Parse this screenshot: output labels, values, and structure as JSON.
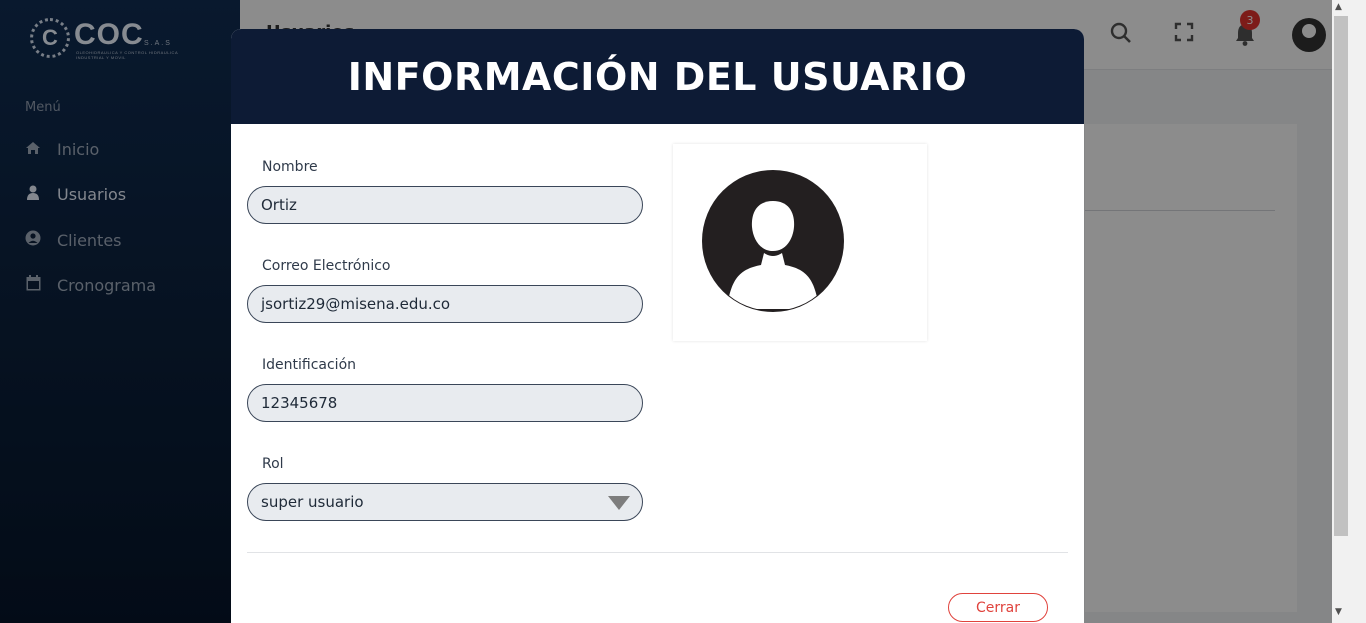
{
  "app": {
    "logo_mark": "C",
    "logo_text": "COC",
    "logo_suffix": "S.A.S",
    "logo_subtitle": "OLEOHIDRAULICA Y CONTROL HIDRAULICA INDUSTRIAL Y MOVIL"
  },
  "sidebar": {
    "menu_title": "Menú",
    "items": [
      {
        "label": "Inicio",
        "icon": "home-icon",
        "active": false
      },
      {
        "label": "Usuarios",
        "icon": "user-icon",
        "active": true
      },
      {
        "label": "Clientes",
        "icon": "user-circle-icon",
        "active": false
      },
      {
        "label": "Cronograma",
        "icon": "calendar-icon",
        "active": false
      }
    ]
  },
  "topbar": {
    "page_title": "Usuarios",
    "notification_count": "3",
    "icons": [
      "search-icon",
      "fullscreen-icon",
      "bell-icon",
      "avatar-icon"
    ]
  },
  "modal": {
    "title": "INFORMACIÓN DEL USUARIO",
    "fields": {
      "nombre": {
        "label": "Nombre",
        "value": "Ortiz"
      },
      "correo": {
        "label": "Correo Electrónico",
        "value": "jsortiz29@misena.edu.co"
      },
      "identificacion": {
        "label": "Identificación",
        "value": "12345678"
      },
      "rol": {
        "label": "Rol",
        "value": "super usuario"
      }
    },
    "close_label": "Cerrar",
    "photo_icon": "user-avatar-placeholder-icon"
  },
  "colors": {
    "sidebar": "#0e2747",
    "modal_header": "#0d1b35",
    "field_bg": "#e8ebef",
    "close_accent": "#e0433d",
    "badge": "#e3342f"
  }
}
